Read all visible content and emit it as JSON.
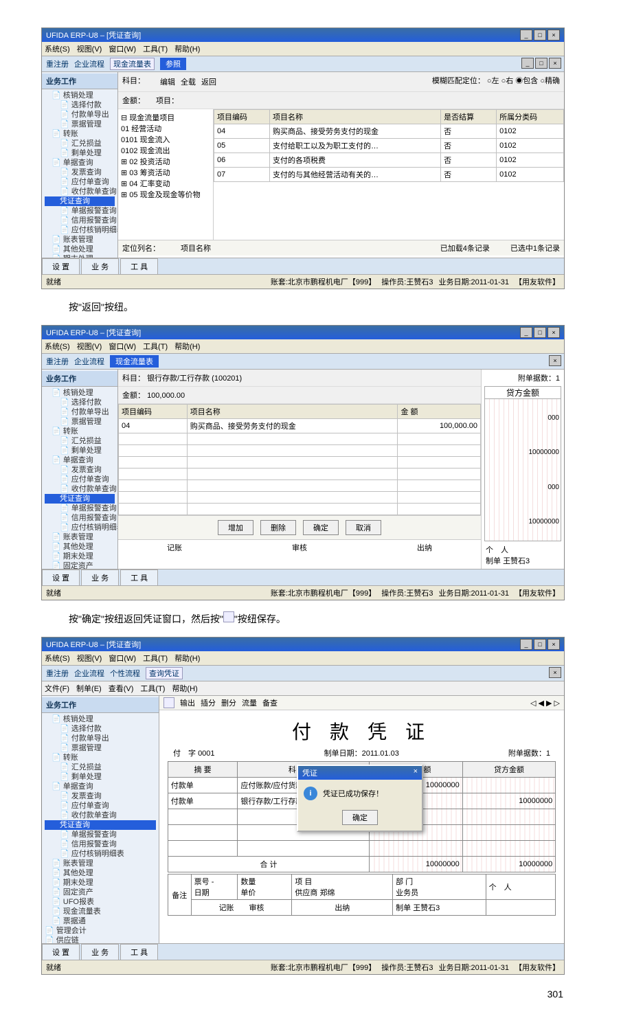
{
  "page_number": "301",
  "app_title": "UFIDA ERP-U8 – [凭证查询]",
  "menus": {
    "sys": "系统(S)",
    "view": "视图(V)",
    "win": "窗口(W)",
    "tool": "工具(T)",
    "help": "帮助(H)"
  },
  "subbar": {
    "rereg": "重注册",
    "flow": "企业流程",
    "pers": "个性流程"
  },
  "sidebar_header": "业务工作",
  "tree_common": [
    "核销处理",
    "选择付款",
    "付款单导出",
    "票据管理",
    "转账",
    "汇兑损益",
    "剩单处理",
    "单据查询",
    "发票查询",
    "应付单查询",
    "收付款单查询",
    "凭证查询",
    "单据报警查询",
    "信用报警查询",
    "应付核销明细表",
    "账表管理",
    "其他处理",
    "期末处理",
    "固定资产",
    "UFO报表",
    "现金流量表",
    "票据通",
    "管理会计",
    "供应链"
  ],
  "bottom_tabs": {
    "settings": "设 置",
    "business": "业 务",
    "tools": "工 具"
  },
  "status": {
    "ready": "就绪",
    "account": "账套:北京市鹏程机电厂【999】",
    "operator": "操作员:王赞石3",
    "date": "业务日期:2011-01-31",
    "vendor": "【用友软件】"
  },
  "s1": {
    "caption": "按\"返回\"按纽。",
    "dialog_tab": "现金流量表",
    "ref_title": "参照",
    "panel": {
      "subject": "科目：",
      "subject_val": "",
      "amount": "金额：",
      "project": "项目："
    },
    "toolbar": {
      "edit": "编辑",
      "all": "全载",
      "return": "返回"
    },
    "match": {
      "label": "模糊匹配定位：",
      "left": "左",
      "right": "右",
      "contain": "包含",
      "exact": "精确"
    },
    "left_tree": [
      "现金流量项目",
      "01 经营活动",
      "0101 现金流入",
      "0102 现金流出",
      "02 投资活动",
      "03 筹资活动",
      "04 汇率变动",
      "05 现金及现金等价物"
    ],
    "grid_headers": [
      "项目编码",
      "项目名称",
      "是否结算",
      "所属分类码"
    ],
    "grid_rows": [
      [
        "04",
        "购买商品、接受劳务支付的现金",
        "否",
        "0102"
      ],
      [
        "05",
        "支付给职工以及为职工支付的…",
        "否",
        "0102"
      ],
      [
        "06",
        "支付的各项税费",
        "否",
        "0102"
      ],
      [
        "07",
        "支付的与其他经营活动有关的…",
        "否",
        "0102"
      ]
    ],
    "footer": {
      "loc_col": "定位列名：",
      "proj_name": "项目名称",
      "loaded": "已加载4条记录",
      "selected": "已选中1条记录"
    }
  },
  "s2": {
    "caption_prefix": "按\"确定\"按纽返回凭证窗口，然后按\"",
    "caption_suffix": "\"按纽保存。",
    "dialog_tab": "现金流量表",
    "panel": {
      "subject": "科目：",
      "subject_val": "银行存款/工行存款 (100201)",
      "amount": "金额：",
      "amount_val": "100,000.00"
    },
    "grid_headers": [
      "项目编码",
      "项目名称",
      "金 额"
    ],
    "grid_row": [
      "04",
      "购买商品、接受劳务支付的现金",
      "100,000.00"
    ],
    "buttons": {
      "add": "增加",
      "del": "删除",
      "ok": "确定",
      "cancel": "取消"
    },
    "right_panel": {
      "attach": "附单据数：1",
      "credit": "贷方金额",
      "vals": [
        "000",
        "10000000",
        "000",
        "10000000"
      ]
    },
    "foot_zone": {
      "person": "个　人",
      "record": "记账",
      "audit": "审核",
      "cashier": "出纳",
      "maker": "制单",
      "maker_name": "王赞石3"
    }
  },
  "s3": {
    "sub_menus": {
      "file": "文件(F)",
      "make": "制单(E)",
      "view": "查看(V)",
      "tool": "工具(T)",
      "help": "帮助(H)"
    },
    "query_tab": "查询凭证",
    "toolbar": {
      "output": "输出",
      "insert": "插分",
      "delete": "删分",
      "flow": "流量",
      "check": "备查"
    },
    "voucher": {
      "title": "付 款 凭 证",
      "prefix": "付",
      "word": "字",
      "no": "0001",
      "make_date_label": "制单日期：",
      "make_date": "2011.01.03",
      "attach": "附单据数：1",
      "headers": [
        "摘 要",
        "科目名称",
        "借方金额",
        "贷方金额"
      ],
      "rows": [
        [
          "付款单",
          "应付账款/应付货款",
          "10000000",
          ""
        ],
        [
          "付款单",
          "银行存款/工行存款",
          "",
          "10000000"
        ]
      ],
      "total_label": "合 计",
      "total_debit": "10000000",
      "total_credit": "10000000",
      "extra": {
        "ticket_no": "票号",
        "date": "日期",
        "qty": "数量",
        "price": "单价",
        "remark": "备注",
        "project": "项 目",
        "dept": "部 门",
        "person": "个　人",
        "supplier": "供应商",
        "supplier_name": "郑绵",
        "biz": "业务员",
        "record": "记账",
        "audit": "审核",
        "cashier": "出纳",
        "maker": "制单",
        "maker_name": "王赞石3"
      }
    },
    "msgbox": {
      "title": "凭证",
      "text": "凭证已成功保存！",
      "ok": "确定"
    }
  }
}
